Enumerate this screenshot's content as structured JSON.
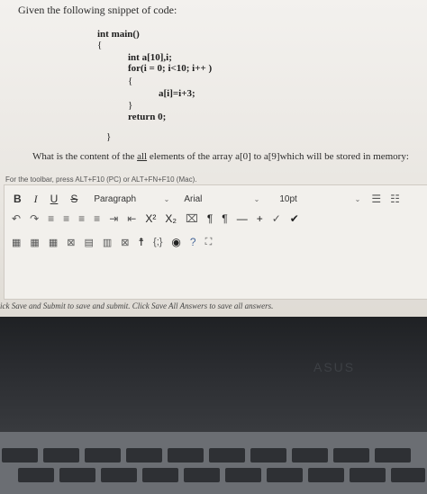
{
  "question": {
    "title": "Given the following snippet of code:",
    "code_lines": [
      "int main()",
      "{",
      "int a[10],i;",
      "for(i = 0; i<10; i++ )",
      "{",
      "a[i]=i+3;",
      "}",
      "return 0;",
      "}"
    ],
    "prompt_before": "What is the content of the ",
    "prompt_underlined": "all",
    "prompt_after": " elements of the array a[0]  to a[9]which will be stored in memory:"
  },
  "editor": {
    "toolbar_hint": "For the toolbar, press ALT+F10 (PC) or ALT+FN+F10 (Mac).",
    "bold": "B",
    "italic": "I",
    "underline": "U",
    "strike": "S",
    "paragraph_select": "Paragraph",
    "font_select": "Arial",
    "size_select": "10pt",
    "superscript": "X²",
    "subscript": "X₂",
    "code_tag": "{;}",
    "help": "?",
    "value": ""
  },
  "footer_text": "ick Save and Submit to save and submit. Click Save All Answers to save all answers.",
  "laptop_logo": "ASUS"
}
